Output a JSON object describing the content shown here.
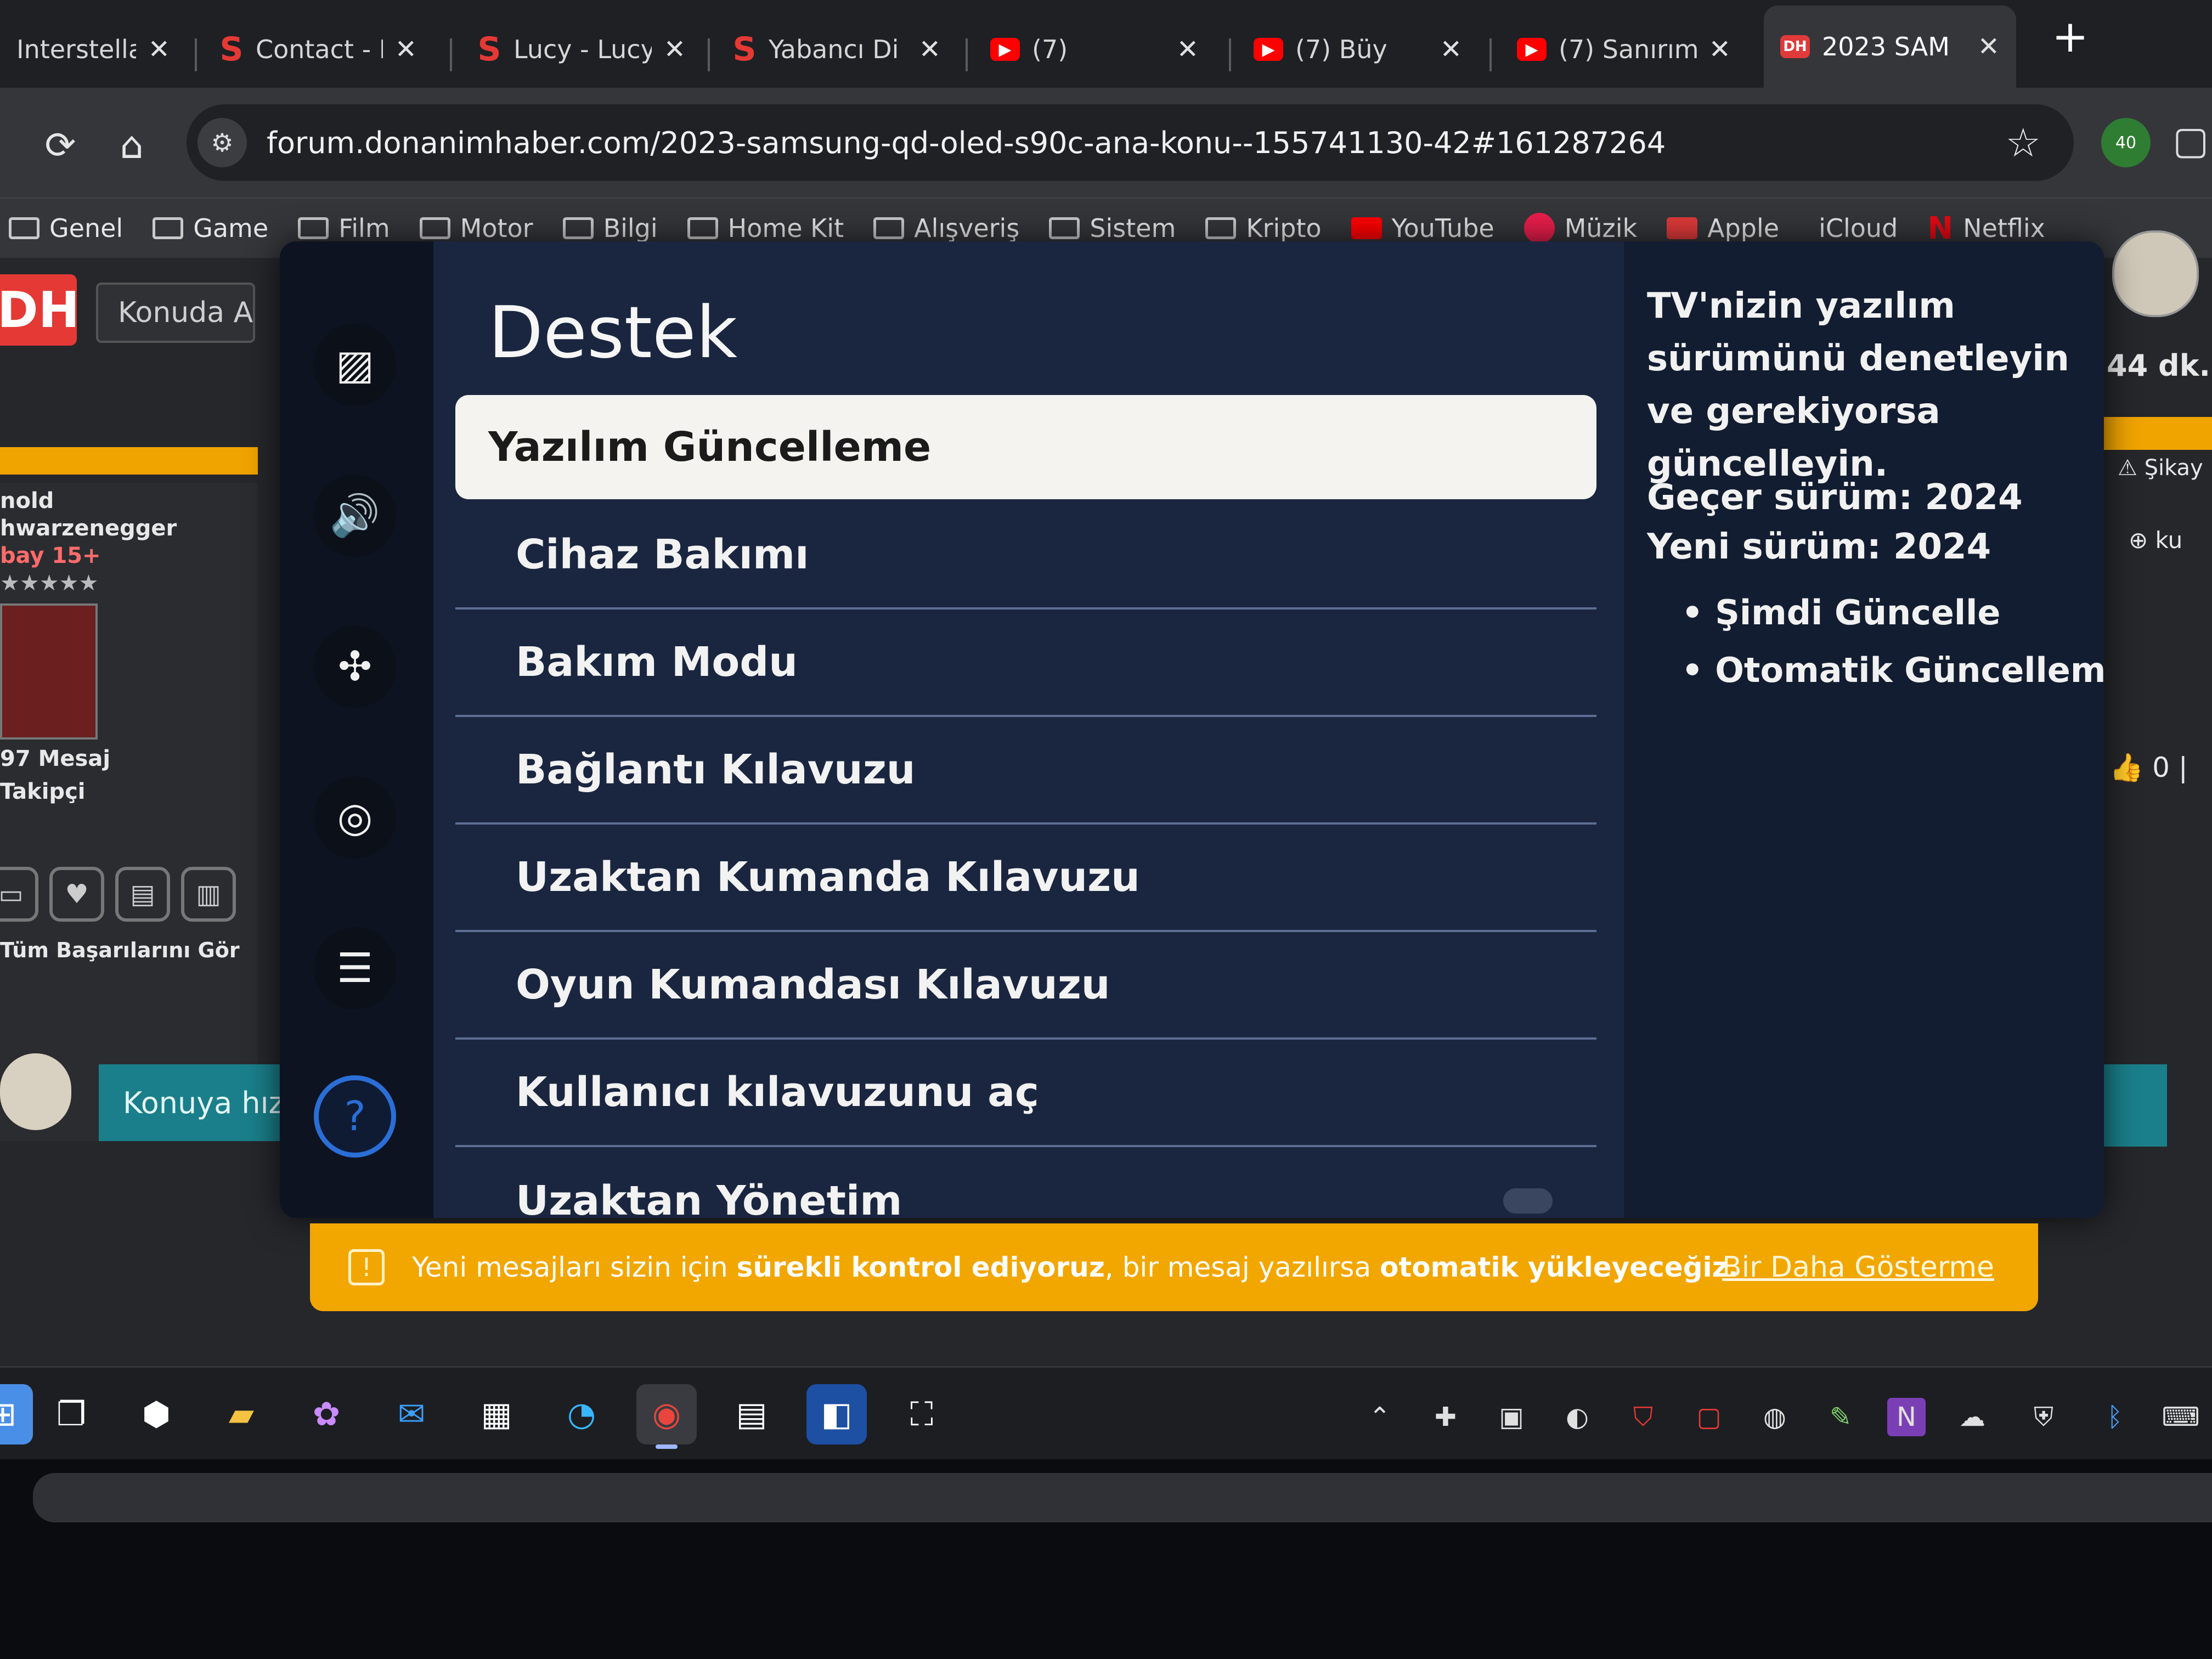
{
  "browser": {
    "tabs": [
      {
        "title": "Interstellar",
        "favicon": "none"
      },
      {
        "title": "Contact - I",
        "favicon": "s-icon"
      },
      {
        "title": "Lucy - Lucy",
        "favicon": "s-icon"
      },
      {
        "title": "Yabancı Di",
        "favicon": "s-icon"
      },
      {
        "title": "(7)",
        "favicon": "youtube-icon"
      },
      {
        "title": "(7) Büy",
        "favicon": "youtube-icon"
      },
      {
        "title": "(7) Sanırım",
        "favicon": "youtube-icon"
      },
      {
        "title": "2023 SAM",
        "favicon": "dh-icon",
        "active": true
      }
    ],
    "url": "forum.donanimhaber.com/2023-samsung-qd-oled-s90c-ana-konu--155741130-42#161287264",
    "extension_badge": "40",
    "bookmarks": [
      "Genel",
      "Game",
      "Film",
      "Motor",
      "Bilgi",
      "Home Kit",
      "Alışveriş",
      "Sistem",
      "Kripto",
      "YouTube",
      "Müzik",
      "Apple",
      "iCloud",
      "Netflix"
    ]
  },
  "forum": {
    "logo": "DH",
    "search_placeholder": "Konuda Ar",
    "user_lines": [
      "nold",
      "hwarzenegger",
      "bay 15+",
      "★★★★★",
      "97 Mesaj",
      "Takipçi"
    ],
    "achievements_link": "Tüm Başarılarını Gör",
    "reply_placeholder": "Konuya hız",
    "time_ago": "44 dk.",
    "report": "Şikay",
    "right_text": "ku",
    "likes": "0"
  },
  "tv": {
    "title": "Destek",
    "menu": [
      "Yazılım Güncelleme",
      "Cihaz Bakımı",
      "Bakım Modu",
      "Bağlantı Kılavuzu",
      "Uzaktan Kumanda Kılavuzu",
      "Oyun Kumandası Kılavuzu",
      "Kullanıcı kılavuzunu aç",
      "Uzaktan Yönetim"
    ],
    "info": {
      "description": "TV'nizin yazılım sürümünü denetleyin ve gerekiyorsa güncelleyin.",
      "current_version": "Geçer sürüm: 2024",
      "new_version": "Yeni sürüm: 2024",
      "options": [
        "• Şimdi Güncelle",
        "• Otomatik Güncelleme"
      ]
    },
    "rail_icons": [
      "picture-icon",
      "sound-icon",
      "connection-icon",
      "broadcast-icon",
      "accessibility-icon",
      "support-icon"
    ]
  },
  "notice": {
    "part1": "Yeni mesajları sizin için ",
    "bold1": "sürekli kontrol ediyoruz",
    "part2": ", bir mesaj yazılırsa ",
    "bold2": "otomatik yükleyeceğiz.",
    "dismiss": "Bir Daha Gösterme"
  },
  "colors": {
    "accent_orange": "#f2a600",
    "tv_selected_bg": "#f4f3f0",
    "tv_panel": "#1a2640",
    "teal": "#1a7f8a"
  }
}
